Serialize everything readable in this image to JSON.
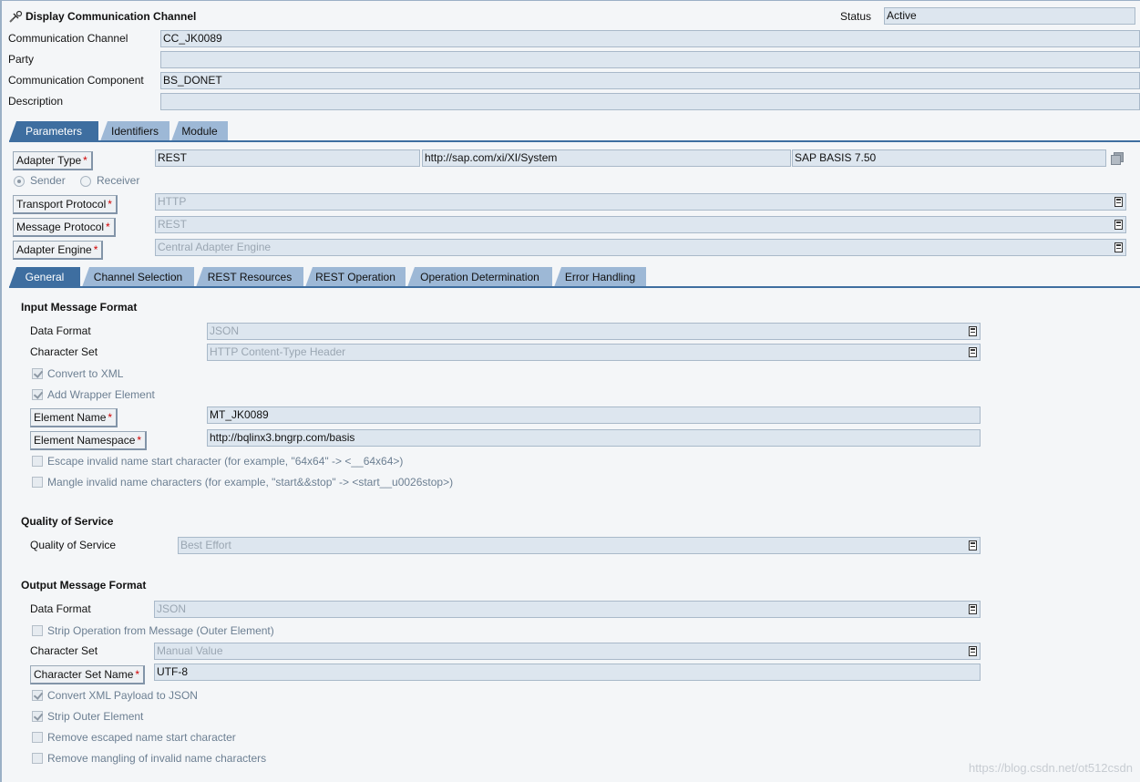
{
  "header": {
    "title": "Display Communication Channel",
    "status_label": "Status",
    "status_value": "Active"
  },
  "channel": {
    "rows": [
      {
        "label": "Communication Channel",
        "value": "CC_JK0089"
      },
      {
        "label": "Party",
        "value": ""
      },
      {
        "label": "Communication Component",
        "value": "BS_DONET"
      },
      {
        "label": "Description",
        "value": ""
      }
    ]
  },
  "main_tabs": [
    {
      "label": "Parameters"
    },
    {
      "label": "Identifiers"
    },
    {
      "label": "Module"
    }
  ],
  "adapter": {
    "type_label": "Adapter Type",
    "type_value": "REST",
    "namespace": "http://sap.com/xi/XI/System",
    "software_component": "SAP BASIS 7.50",
    "sender_label": "Sender",
    "receiver_label": "Receiver",
    "direction_selected": "Sender",
    "transport_label": "Transport Protocol",
    "transport_value": "HTTP",
    "message_label": "Message Protocol",
    "message_value": "REST",
    "engine_label": "Adapter Engine",
    "engine_value": "Central Adapter Engine"
  },
  "sub_tabs": [
    {
      "label": "General"
    },
    {
      "label": "Channel Selection"
    },
    {
      "label": "REST Resources"
    },
    {
      "label": "REST Operation"
    },
    {
      "label": "Operation Determination"
    },
    {
      "label": "Error Handling"
    }
  ],
  "input_format": {
    "title": "Input Message Format",
    "data_format_label": "Data Format",
    "data_format_value": "JSON",
    "charset_label": "Character Set",
    "charset_value": "HTTP Content-Type Header",
    "convert_xml_label": "Convert to XML",
    "convert_xml_checked": true,
    "add_wrapper_label": "Add Wrapper Element",
    "add_wrapper_checked": true,
    "element_name_label": "Element Name",
    "element_name_value": "MT_JK0089",
    "element_ns_label": "Element Namespace",
    "element_ns_value": "http://bqlinx3.bngrp.com/basis",
    "escape_label": "Escape invalid name start character (for example, \"64x64\" -> <__64x64>)",
    "escape_checked": false,
    "mangle_label": "Mangle invalid name characters (for example, \"start&&stop\" -> <start__u0026stop>)",
    "mangle_checked": false
  },
  "qos": {
    "title": "Quality of Service",
    "label": "Quality of Service",
    "value": "Best Effort"
  },
  "output_format": {
    "title": "Output Message Format",
    "data_format_label": "Data Format",
    "data_format_value": "JSON",
    "strip_op_label": "Strip Operation from Message (Outer Element)",
    "strip_op_checked": false,
    "charset_label": "Character Set",
    "charset_value": "Manual Value",
    "charset_name_label": "Character Set Name",
    "charset_name_value": "UTF-8",
    "convert_json_label": "Convert XML Payload to JSON",
    "convert_json_checked": true,
    "strip_outer_label": "Strip Outer Element",
    "strip_outer_checked": true,
    "remove_escaped_label": "Remove escaped name start character",
    "remove_escaped_checked": false,
    "remove_mangling_label": "Remove mangling of invalid name characters",
    "remove_mangling_checked": false
  },
  "watermark": "https://blog.csdn.net/ot512csdn"
}
